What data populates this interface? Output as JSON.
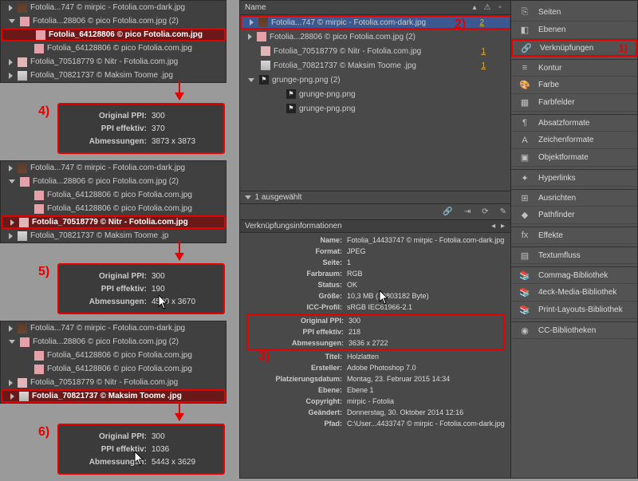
{
  "midHeader": {
    "name": "Name"
  },
  "midList": [
    {
      "type": "bricks",
      "txt": "Fotolia...747 © mirpic - Fotolia.com-dark.jpg",
      "sel": true,
      "chev": true,
      "badge": "2"
    },
    {
      "type": "pink",
      "txt": "Fotolia...28806 © pico Fotolia.com.jpg (2)",
      "chev": true
    },
    {
      "type": "pink2",
      "txt": "Fotolia_70518779 © Nitr - Fotolia.com.jpg",
      "badge": "1"
    },
    {
      "type": "person",
      "txt": "Fotolia_70821737 © Maksim Toome .jpg",
      "badge": "1"
    },
    {
      "type": "png",
      "txt": "grunge-png.png (2)",
      "chev": true,
      "open": true
    },
    {
      "type": "png",
      "txt": "grunge-png.png",
      "sub": true
    },
    {
      "type": "png",
      "txt": "grunge-png.png",
      "sub": true
    }
  ],
  "selCount": "1 ausgewählt",
  "infoTitle": "Verknüpfungsinformationen",
  "info": {
    "Name": "Fotolia_14433747 © mirpic - Fotolia.com-dark.jpg",
    "Format": "JPEG",
    "Seite": "1",
    "Farbraum": "RGB",
    "Status": "OK",
    "Größe": "10,3 MB (10803182 Byte)",
    "ICC-Profil": "sRGB IEC61966-2.1",
    "Original PPI": "300",
    "PPI effektiv": "218",
    "Abmessungen": "3636 x 2722",
    "Titel": "Holzlatten",
    "Ersteller": "Adobe Photoshop 7.0",
    "Platzierungsdatum": "Montag, 23. Februar 2015 14:34",
    "Ebene": "Ebene 1",
    "Copyright": "mirpic - Fotolia",
    "Geändert": "Donnerstag, 30. Oktober 2014 12:16",
    "Pfad": "C:\\User...4433747 © mirpic - Fotolia.com-dark.jpg"
  },
  "right": [
    {
      "icon": "⎘",
      "label": "Seiten"
    },
    {
      "icon": "◧",
      "label": "Ebenen"
    },
    {
      "icon": "🔗",
      "label": "Verknüpfungen",
      "hi": true,
      "num": "1)"
    },
    {
      "icon": "≡",
      "label": "Kontur",
      "sep": true
    },
    {
      "icon": "🎨",
      "label": "Farbe"
    },
    {
      "icon": "▦",
      "label": "Farbfelder"
    },
    {
      "icon": "¶",
      "label": "Absatzformate",
      "sep": true
    },
    {
      "icon": "A",
      "label": "Zeichenformate"
    },
    {
      "icon": "▣",
      "label": "Objektformate"
    },
    {
      "icon": "✦",
      "label": "Hyperlinks",
      "sep": true
    },
    {
      "icon": "⊞",
      "label": "Ausrichten",
      "sep": true
    },
    {
      "icon": "◆",
      "label": "Pathfinder"
    },
    {
      "icon": "fx",
      "label": "Effekte",
      "sep": true
    },
    {
      "icon": "▤",
      "label": "Textumfluss",
      "sep": true
    },
    {
      "icon": "📚",
      "label": "Commag-Bibliothek",
      "sep": true
    },
    {
      "icon": "📚",
      "label": "4eck-Media-Bibliothek"
    },
    {
      "icon": "📚",
      "label": "Print-Layouts-Bibliothek"
    },
    {
      "icon": "◉",
      "label": "CC-Bibliotheken",
      "sep": true
    }
  ],
  "blocks": [
    {
      "rows": [
        {
          "type": "bricks",
          "txt": "Fotolia...747 © mirpic - Fotolia.com-dark.jpg",
          "chev": true
        },
        {
          "type": "pink",
          "txt": "Fotolia...28806 © pico Fotolia.com.jpg (2)",
          "open": true
        },
        {
          "type": "pink",
          "txt": "Fotolia_64128806 © pico Fotolia.com.jpg",
          "hi": true,
          "sub": true,
          "red": true
        },
        {
          "type": "pink",
          "txt": "Fotolia_64128806 © pico Fotolia.com.jpg",
          "sub": true
        },
        {
          "type": "pink2",
          "txt": "Fotolia_70518779 © Nitr - Fotolia.com.jpg",
          "chev": true
        },
        {
          "type": "person",
          "txt": "Fotolia_70821737 © Maksim Toome .jpg",
          "chev": true
        }
      ],
      "info": {
        "Original PPI": "300",
        "PPI effektiv": "370",
        "Abmessungen": "3873 x 3873"
      },
      "marker": "4)"
    },
    {
      "rows": [
        {
          "type": "bricks",
          "txt": "Fotolia...747 © mirpic - Fotolia.com-dark.jpg",
          "chev": true
        },
        {
          "type": "pink",
          "txt": "Fotolia...28806 © pico Fotolia.com.jpg (2)",
          "open": true
        },
        {
          "type": "pink",
          "txt": "Fotolia_64128806 © pico Fotolia.com.jpg",
          "sub": true
        },
        {
          "type": "pink",
          "txt": "Fotolia_64128806 © pico Fotolia.com.jpg",
          "sub": true
        },
        {
          "type": "pink2",
          "txt": "Fotolia_70518779 © Nitr - Fotolia.com.jpg",
          "hi": true,
          "red": true,
          "chev": true
        },
        {
          "type": "person",
          "txt": "Fotolia_70821737 © Maksim Toome .jp",
          "chev": true
        }
      ],
      "info": {
        "Original PPI": "300",
        "PPI effektiv": "190",
        "Abmessungen": "4500 x 3670"
      },
      "marker": "5)"
    },
    {
      "rows": [
        {
          "type": "bricks",
          "txt": "Fotolia...747 © mirpic - Fotolia.com-dark.jpg",
          "chev": true
        },
        {
          "type": "pink",
          "txt": "Fotolia...28806 © pico Fotolia.com.jpg (2)",
          "open": true
        },
        {
          "type": "pink",
          "txt": "Fotolia_64128806 © pico Fotolia.com.jpg",
          "sub": true
        },
        {
          "type": "pink",
          "txt": "Fotolia_64128806 © pico Fotolia.com.jpg",
          "sub": true
        },
        {
          "type": "pink2",
          "txt": "Fotolia_70518779 © Nitr - Fotolia.com.jpg",
          "chev": true
        },
        {
          "type": "person",
          "txt": "Fotolia_70821737 © Maksim Toome .jpg",
          "hi": true,
          "red": true,
          "chev": true
        }
      ],
      "info": {
        "Original PPI": "300",
        "PPI effektiv": "1036",
        "Abmessungen": "5443 x 3629"
      },
      "marker": "6)"
    }
  ],
  "marker2": "2)",
  "marker3": "3)"
}
